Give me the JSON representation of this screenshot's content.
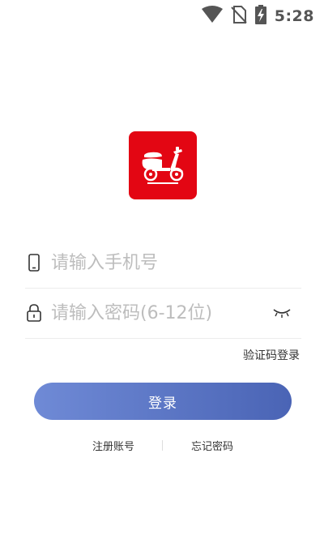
{
  "status_bar": {
    "time": "5:28",
    "icons": [
      "wifi-icon",
      "no-sim-icon",
      "battery-charging-icon"
    ]
  },
  "app": {
    "logo_icon": "scooter-icon",
    "brand_color": "#e30613"
  },
  "form": {
    "phone": {
      "icon": "phone-icon",
      "placeholder": "请输入手机号",
      "value": ""
    },
    "password": {
      "icon": "lock-icon",
      "placeholder": "请输入密码(6-12位)",
      "value": "",
      "toggle_icon": "eye-closed-icon"
    },
    "sms_login_link": "验证码登录",
    "login_button": "登录"
  },
  "footer": {
    "register": "注册账号",
    "forgot_password": "忘记密码"
  },
  "colors": {
    "button_start": "#6f8ad6",
    "button_end": "#4a64b5"
  }
}
